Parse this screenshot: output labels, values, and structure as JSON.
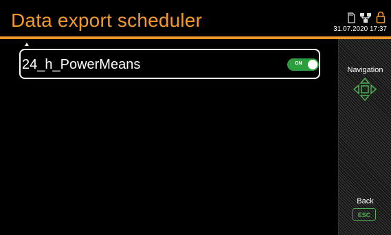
{
  "header": {
    "title": "Data export scheduler",
    "datetime": "31.07.2020  17:37",
    "icons": [
      "sd-card-icon",
      "network-icon",
      "lock-icon"
    ],
    "accent_color": "#f39a2b"
  },
  "list": {
    "items": [
      {
        "label": "24_h_PowerMeans",
        "toggle": {
          "state": "ON",
          "color": "#2d9e3d"
        }
      }
    ]
  },
  "sidebar": {
    "navigation_label": "Navigation",
    "back_label": "Back",
    "esc_label": "ESC",
    "accent_color": "#4caf50"
  }
}
